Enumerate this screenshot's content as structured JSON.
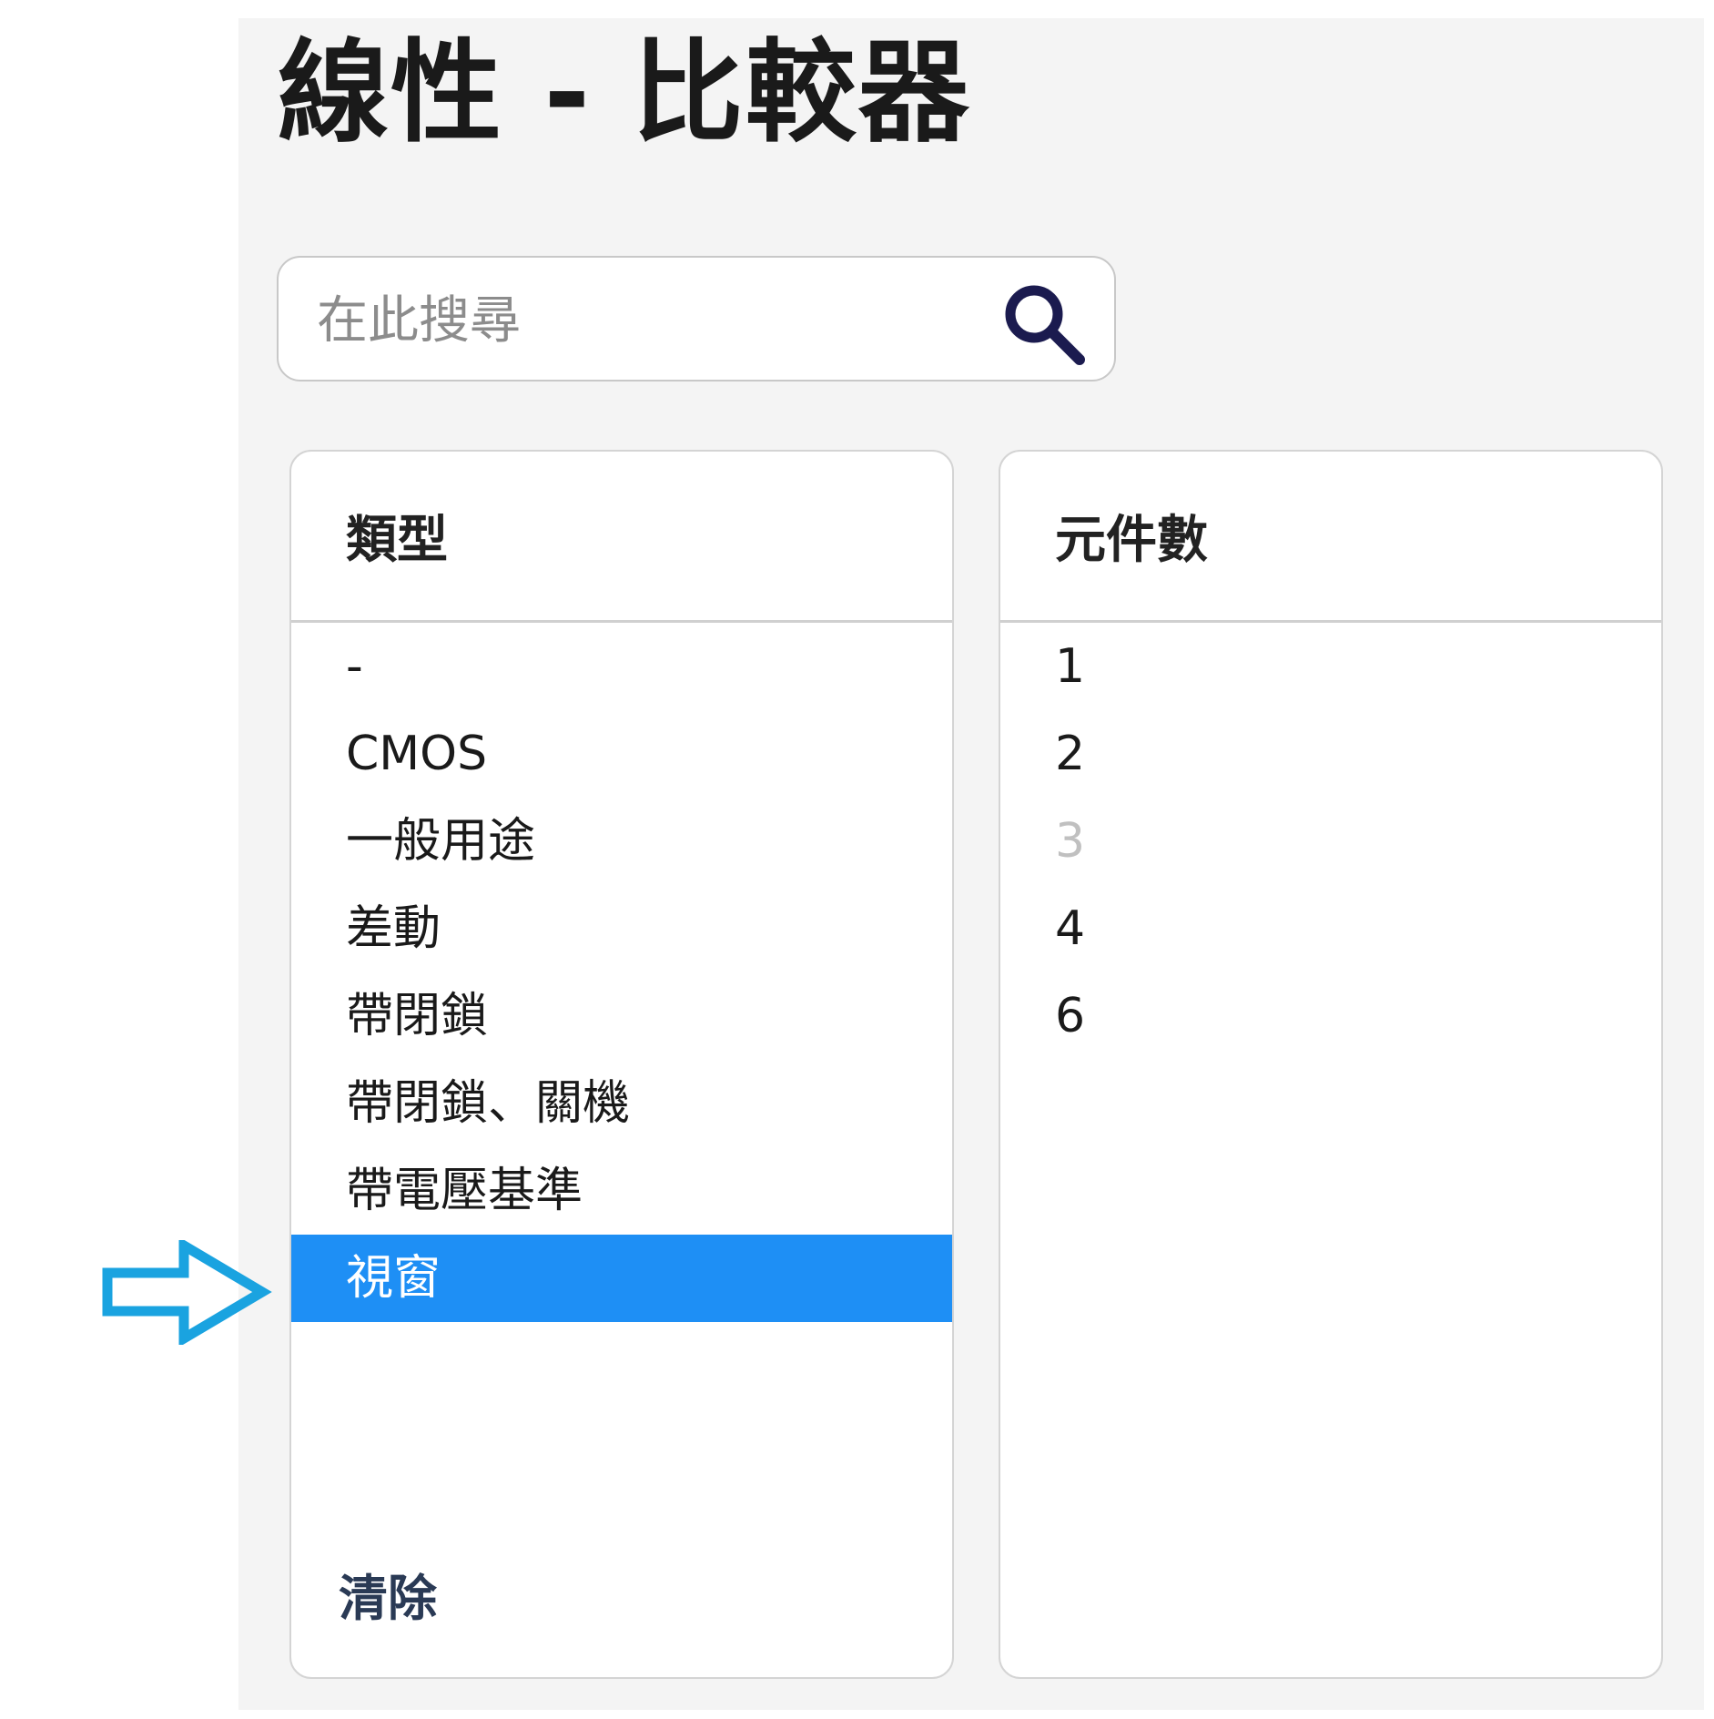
{
  "page": {
    "title": "線性 - 比較器"
  },
  "search": {
    "placeholder": "在此搜尋",
    "icon": "search-icon"
  },
  "filters": {
    "type": {
      "header": "類型",
      "options": [
        "-",
        "CMOS",
        "一般用途",
        "差動",
        "帶閉鎖",
        "帶閉鎖、關機",
        "帶電壓基準",
        "視窗"
      ],
      "selected": "視窗",
      "clear_label": "清除"
    },
    "element_count": {
      "header": "元件數",
      "options": [
        "1",
        "2",
        "3",
        "4",
        "6"
      ],
      "disabled": [
        "3"
      ]
    }
  },
  "annotation": {
    "icon": "arrow-right-icon",
    "color": "#1aa3e0"
  },
  "colors": {
    "selected_bg": "#1e8ff5",
    "search_icon": "#1b1b4f"
  }
}
